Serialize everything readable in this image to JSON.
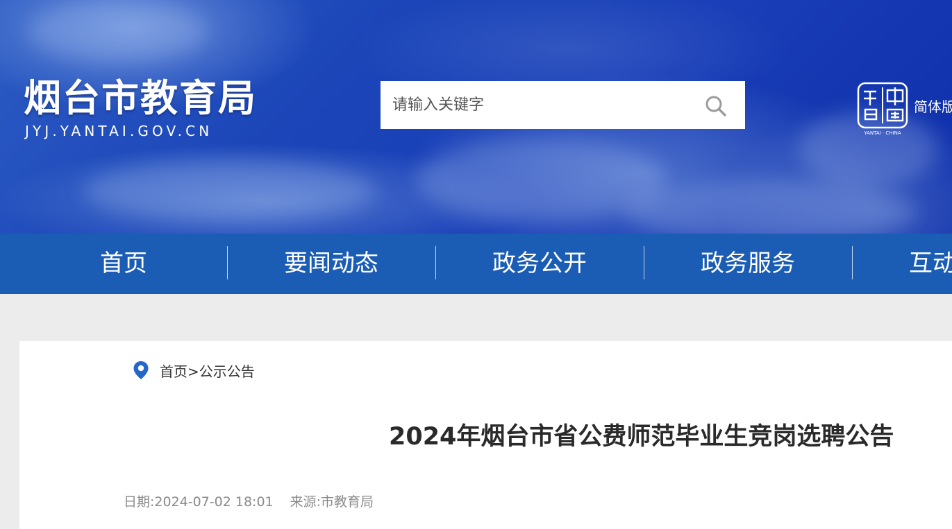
{
  "site": {
    "title": "烟台市教育局",
    "subtitle": "JYJ.YANTAI.GOV.CN",
    "emblem_text": "YANTAI · CHINA",
    "language_label": "简体版"
  },
  "search": {
    "placeholder": "请输入关键字",
    "icon": "search-icon"
  },
  "nav": {
    "items": [
      {
        "label": "首页"
      },
      {
        "label": "要闻动态"
      },
      {
        "label": "政务公开"
      },
      {
        "label": "政务服务"
      },
      {
        "label": "互动交流"
      }
    ]
  },
  "breadcrumb": {
    "icon": "location-pin-icon",
    "home": "首页",
    "separator": ">",
    "current": "公示公告"
  },
  "article": {
    "title": "2024年烟台市省公费师范毕业生竞岗选聘公告",
    "date": "日期:2024-07-02 18:01",
    "source": "来源:市教育局"
  },
  "colors": {
    "header_blue": "#1a3fb8",
    "nav_blue": "#1b5cb4",
    "pin_blue": "#2567c8",
    "page_bg": "#ececec"
  }
}
